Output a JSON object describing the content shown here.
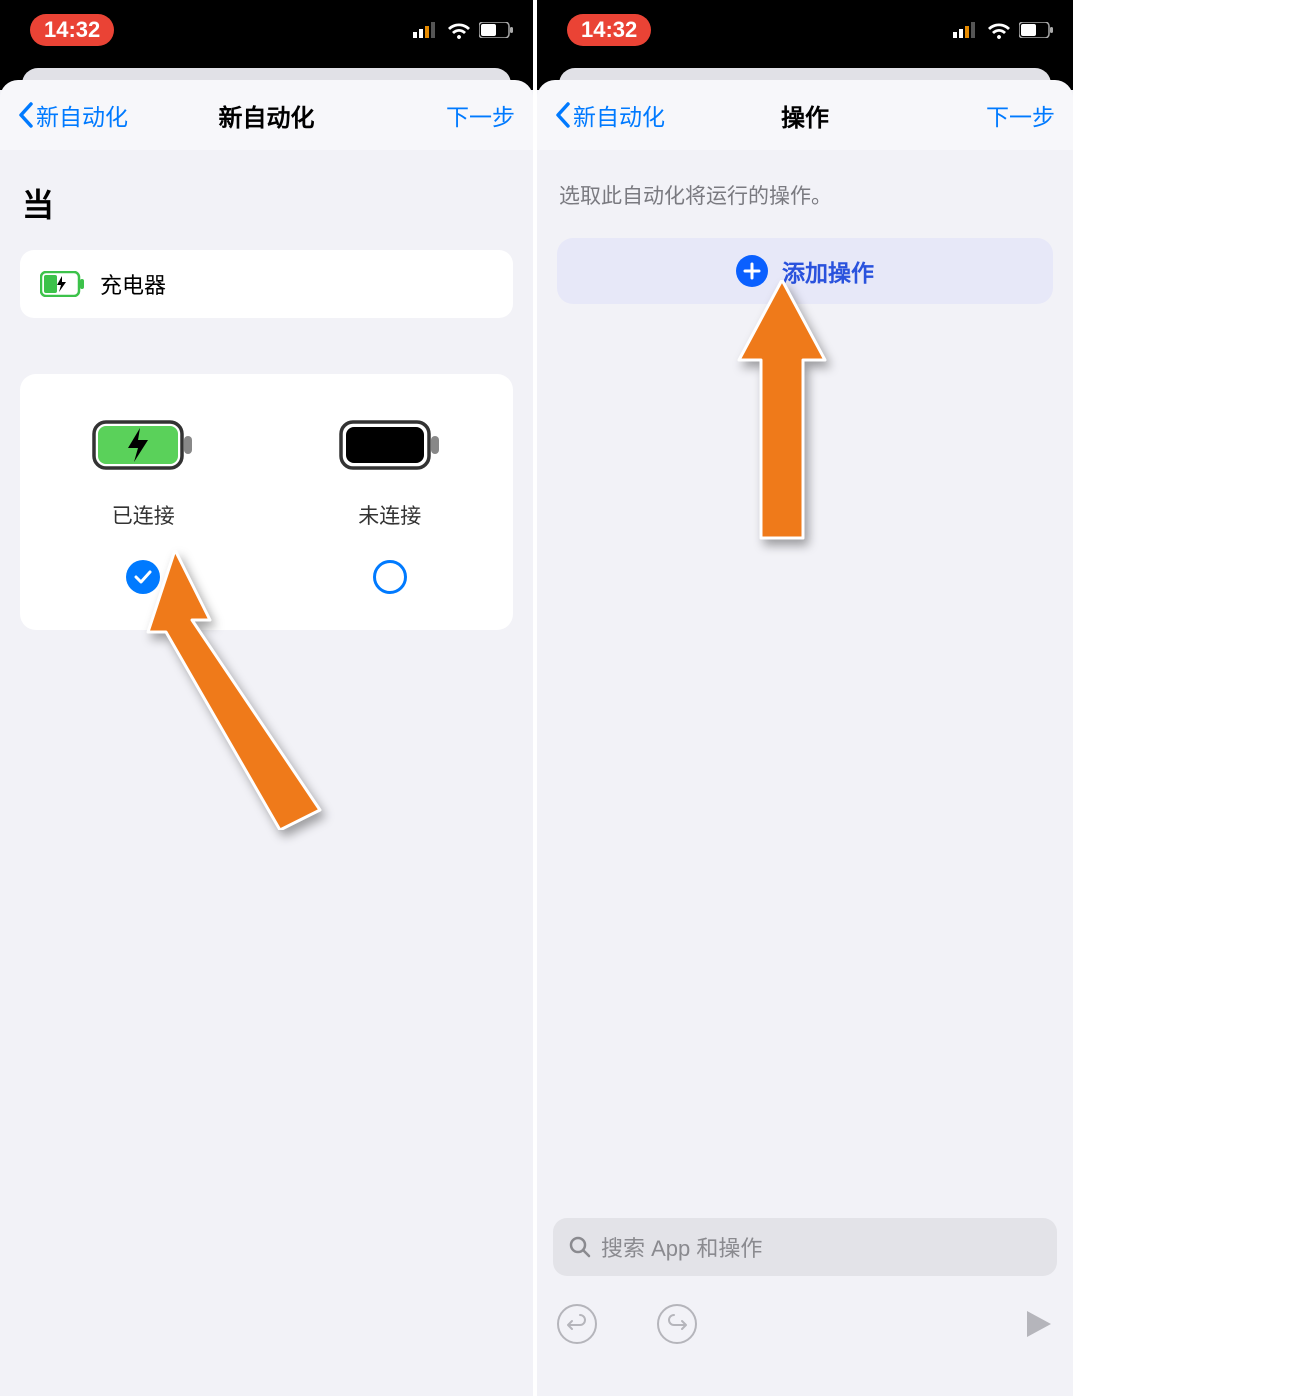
{
  "status": {
    "time": "14:32"
  },
  "left": {
    "nav": {
      "back": "新自动化",
      "title": "新自动化",
      "next": "下一步"
    },
    "when_label": "当",
    "trigger": {
      "label": "充电器"
    },
    "options": {
      "connected": "已连接",
      "disconnected": "未连接"
    }
  },
  "right": {
    "nav": {
      "back": "新自动化",
      "title": "操作",
      "next": "下一步"
    },
    "subtitle": "选取此自动化将运行的操作。",
    "add_action": "添加操作",
    "search_placeholder": "搜索 App 和操作"
  }
}
